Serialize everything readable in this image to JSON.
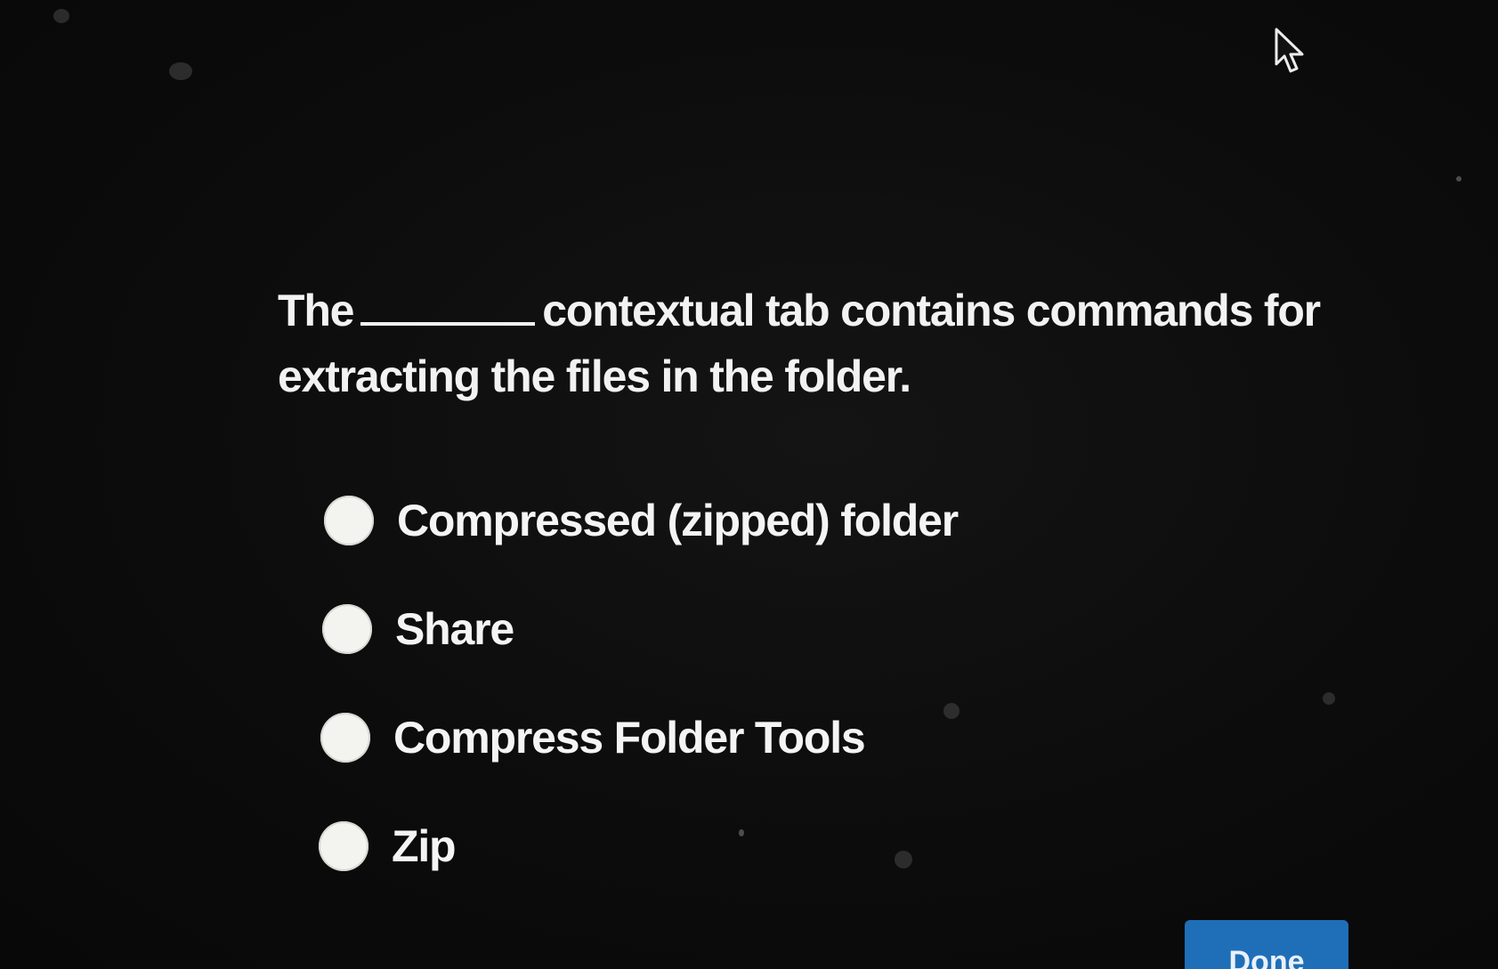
{
  "question": {
    "before_blank": "The",
    "after_blank": "contextual tab contains commands for extracting the files in the folder."
  },
  "options": [
    {
      "label": "Compressed (zipped) folder"
    },
    {
      "label": "Share"
    },
    {
      "label": "Compress Folder Tools"
    },
    {
      "label": "Zip"
    }
  ],
  "done_button": {
    "label": "Done"
  },
  "colors": {
    "background": "#0c0c0c",
    "text": "#f4f4f4",
    "radio_fill": "#f3f3f0",
    "button_blue": "#1f6fb8"
  },
  "icons": {
    "cursor": "mouse-pointer-icon"
  }
}
